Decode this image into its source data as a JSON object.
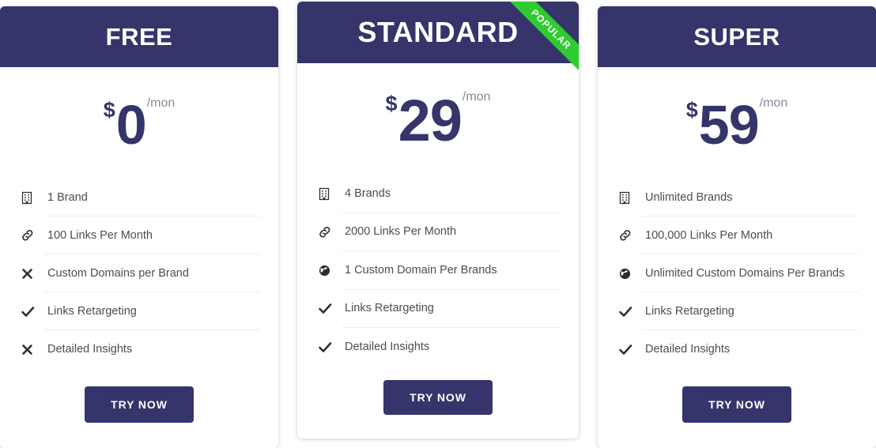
{
  "theme": {
    "header_bg": "#35356b",
    "ribbon_bg": "#2ecc2e",
    "price_color": "#35356b",
    "button_bg": "#35356b",
    "page_bg": "#ffffff",
    "divider": "#eeeeee",
    "feature_text": "#4d4d4d",
    "period_text": "#8a8a99"
  },
  "plans": [
    {
      "name": "FREE",
      "currency": "$",
      "amount": "0",
      "period": "/mon",
      "ribbon": null,
      "features": [
        {
          "icon": "building-icon",
          "label": "1 Brand"
        },
        {
          "icon": "link-icon",
          "label": "100 Links Per Month"
        },
        {
          "icon": "cross-icon",
          "label": "Custom Domains per Brand"
        },
        {
          "icon": "check-icon",
          "label": "Links Retargeting"
        },
        {
          "icon": "cross-icon",
          "label": "Detailed Insights"
        }
      ],
      "cta": "TRY NOW"
    },
    {
      "name": "STANDARD",
      "currency": "$",
      "amount": "29",
      "period": "/mon",
      "ribbon": "POPULAR",
      "features": [
        {
          "icon": "building-icon",
          "label": "4 Brands"
        },
        {
          "icon": "link-icon",
          "label": "2000 Links Per Month"
        },
        {
          "icon": "globe-icon",
          "label": "1 Custom Domain Per Brands"
        },
        {
          "icon": "check-icon",
          "label": "Links Retargeting"
        },
        {
          "icon": "check-icon",
          "label": "Detailed Insights"
        }
      ],
      "cta": "TRY NOW"
    },
    {
      "name": "SUPER",
      "currency": "$",
      "amount": "59",
      "period": "/mon",
      "ribbon": null,
      "features": [
        {
          "icon": "building-icon",
          "label": "Unlimited Brands"
        },
        {
          "icon": "link-icon",
          "label": "100,000 Links Per Month"
        },
        {
          "icon": "globe-icon",
          "label": "Unlimited Custom Domains Per Brands"
        },
        {
          "icon": "check-icon",
          "label": "Links Retargeting"
        },
        {
          "icon": "check-icon",
          "label": "Detailed Insights"
        }
      ],
      "cta": "TRY NOW"
    }
  ]
}
